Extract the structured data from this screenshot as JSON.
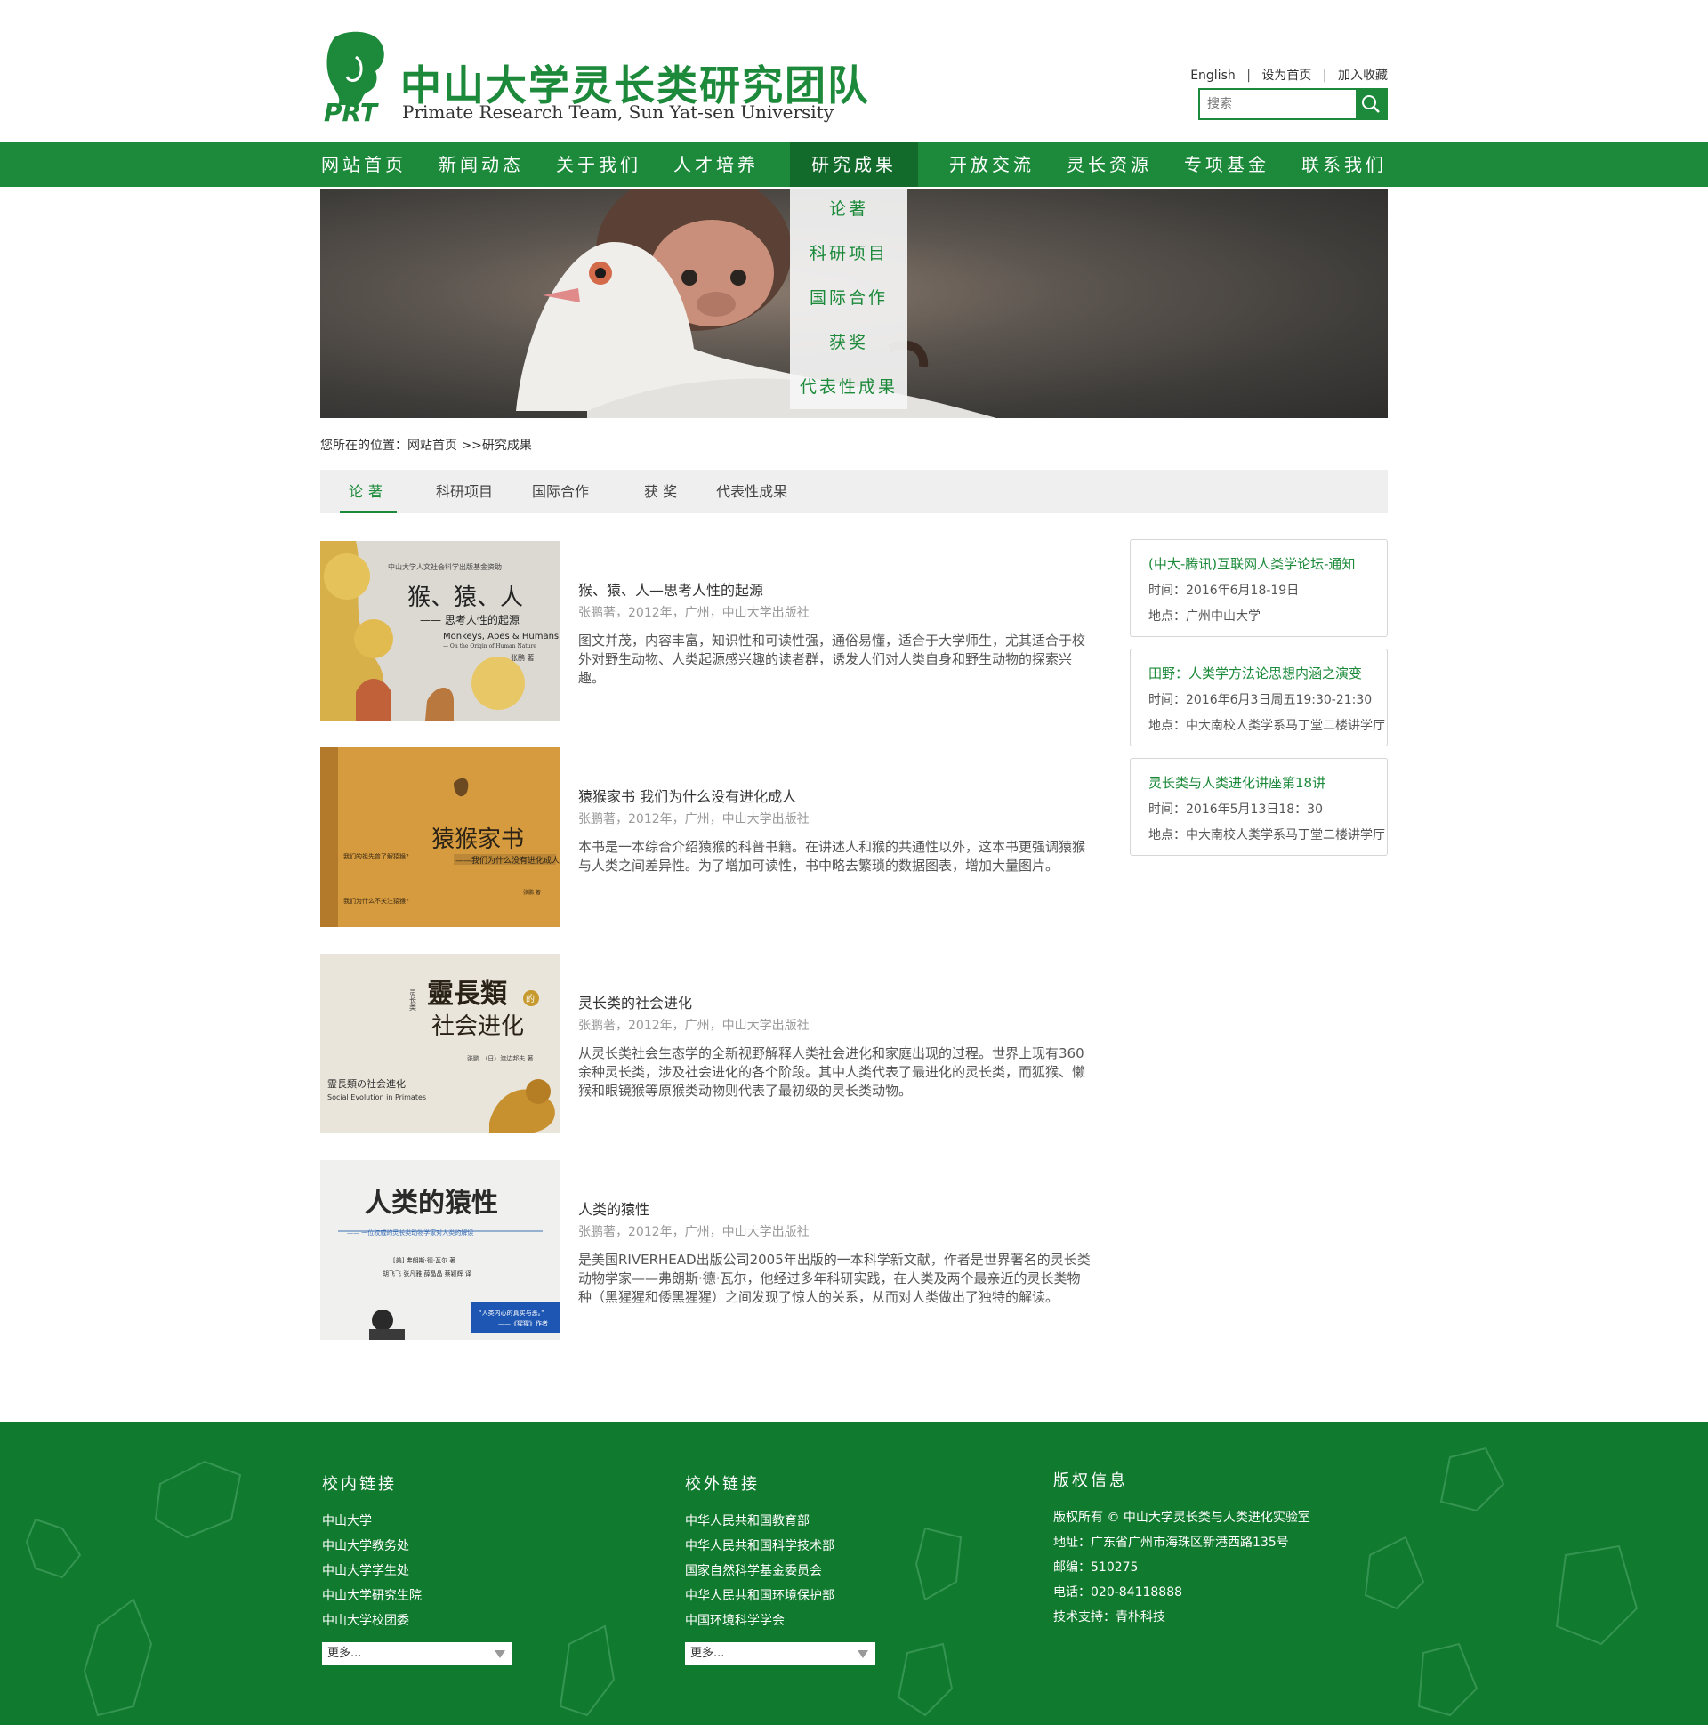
{
  "header": {
    "title": "中山大学灵长类研究团队",
    "subtitle": "Primate Research Team, Sun Yat-sen University",
    "logo_text": "PRT",
    "links": [
      "English",
      "设为首页",
      "加入收藏"
    ],
    "search_placeholder": "搜索"
  },
  "nav": {
    "items": [
      "网站首页",
      "新闻动态",
      "关于我们",
      "人才培养",
      "研究成果",
      "开放交流",
      "灵长资源",
      "专项基金",
      "联系我们"
    ],
    "active": "研究成果",
    "dropdown": [
      "论著",
      "科研项目",
      "国际合作",
      "获奖",
      "代表性成果"
    ]
  },
  "breadcrumb": "您所在的位置：网站首页 >>研究成果",
  "tabs": [
    "论著",
    "科研项目",
    "国际合作",
    "获 奖",
    "代表性成果"
  ],
  "books": [
    {
      "title": "猴、猿、人—思考人性的起源",
      "meta": "张鹏著，2012年，广州，中山大学出版社",
      "desc": "图文并茂，内容丰富，知识性和可读性强，通俗易懂，适合于大学师生，尤其适合于校外对野生动物、人类起源感兴趣的读者群，诱发人们对人类自身和野生动物的探索兴趣。",
      "cover": {
        "top": "中山大学人文社会科学出版基金资助",
        "title": "猴、猿、人",
        "sub": "—— 思考人性的起源",
        "en": "Monkeys, Apes & Humans",
        "en2": "— On the Origin of Human Nature",
        "author": "张鹏 著",
        "bg": "#d9d6cf"
      }
    },
    {
      "title": "猿猴家书 我们为什么没有进化成人",
      "meta": "张鹏著，2012年，广州，中山大学出版社",
      "desc": "本书是一本综合介绍猿猴的科普书籍。在讲述人和猴的共通性以外，这本书更强调猿猴与人类之间差异性。为了增加可读性，书中略去繁琐的数据图表，增加大量图片。",
      "cover": {
        "title": "猿猴家书",
        "sub": "——我们为什么没有进化成人",
        "q1": "我们的祖先曾了解猿猴?",
        "q2": "我们为什么不关注猿猴?",
        "author": "张鹏 著",
        "bg": "#d69b3e"
      }
    },
    {
      "title": "灵长类的社会进化",
      "meta": "张鹏著，2012年，广州，中山大学出版社",
      "desc": "从灵长类社会生态学的全新视野解释人类社会进化和家庭出现的过程。世界上现有360余种灵长类，涉及社会进化的各个阶段。其中人类代表了最进化的灵长类，而狐猴、懒猴和眼镜猴等原猴类动物则代表了最初级的灵长类动物。",
      "cover": {
        "title": "靈長類",
        "sub": "社会进化",
        "mark": "的",
        "side": "灵长类",
        "jp": "霊長類の社会進化",
        "en": "Social Evolution in Primates",
        "author": "张鹏 （日）渡边邦夫 著",
        "bg": "#eae5da"
      }
    },
    {
      "title": "人类的猿性",
      "meta": "张鹏著，2012年，广州，中山大学出版社",
      "desc": "是美国RIVERHEAD出版公司2005年出版的一本科学新文献，作者是世界著名的灵长类动物学家——弗朗斯·德·瓦尔，他经过多年科研实践，在人类及两个最亲近的灵长类物种（黑猩猩和倭黑猩猩）之间发现了惊人的关系，从而对人类做出了独特的解读。",
      "cover": {
        "title": "人类的猿性",
        "sub": "—— 一位权威的灵长类动物学家对人类的解读",
        "author": "[美] 弗朗斯·德·瓦尔 著",
        "translators": "胡飞飞 张凡雅 薛晶晶 蔡颖辉 译",
        "quote": "“人类内心的真实与恶。”",
        "quote2": "——《猩猩》作者",
        "bg": "#f0f0ee"
      }
    }
  ],
  "events": [
    {
      "title": "(中大-腾讯)互联网人类学论坛-通知",
      "time": "时间：2016年6月18-19日",
      "place": "地点：广州中山大学"
    },
    {
      "title": "田野：人类学方法论思想内涵之演变",
      "time": "时间：2016年6月3日周五19:30-21:30",
      "place": "地点：中大南校人类学系马丁堂二楼讲学厅"
    },
    {
      "title": "灵长类与人类进化讲座第18讲",
      "time": "时间：2016年5月13日18：30",
      "place": "地点：中大南校人类学系马丁堂二楼讲学厅"
    }
  ],
  "footer": {
    "campus": {
      "heading": "校内链接",
      "items": [
        "中山大学",
        "中山大学教务处",
        "中山大学学生处",
        "中山大学研究生院",
        "中山大学校团委"
      ],
      "select": "更多..."
    },
    "external": {
      "heading": "校外链接",
      "items": [
        "中华人民共和国教育部",
        "中华人民共和国科学技术部",
        "国家自然科学基金委员会",
        "中华人民共和国环境保护部",
        "中国环境科学学会"
      ],
      "select": "更多..."
    },
    "copyright": {
      "heading": "版权信息",
      "items": [
        "版权所有 © 中山大学灵长类与人类进化实验室",
        "地址：广东省广州市海珠区新港西路135号",
        "邮编：510275",
        "电话：020-84118888",
        "技术支持：青朴科技"
      ]
    }
  },
  "colors": {
    "brand_green": "#1c8a3a",
    "footer_green": "#107a2e",
    "nav_active": "#126b2b"
  }
}
